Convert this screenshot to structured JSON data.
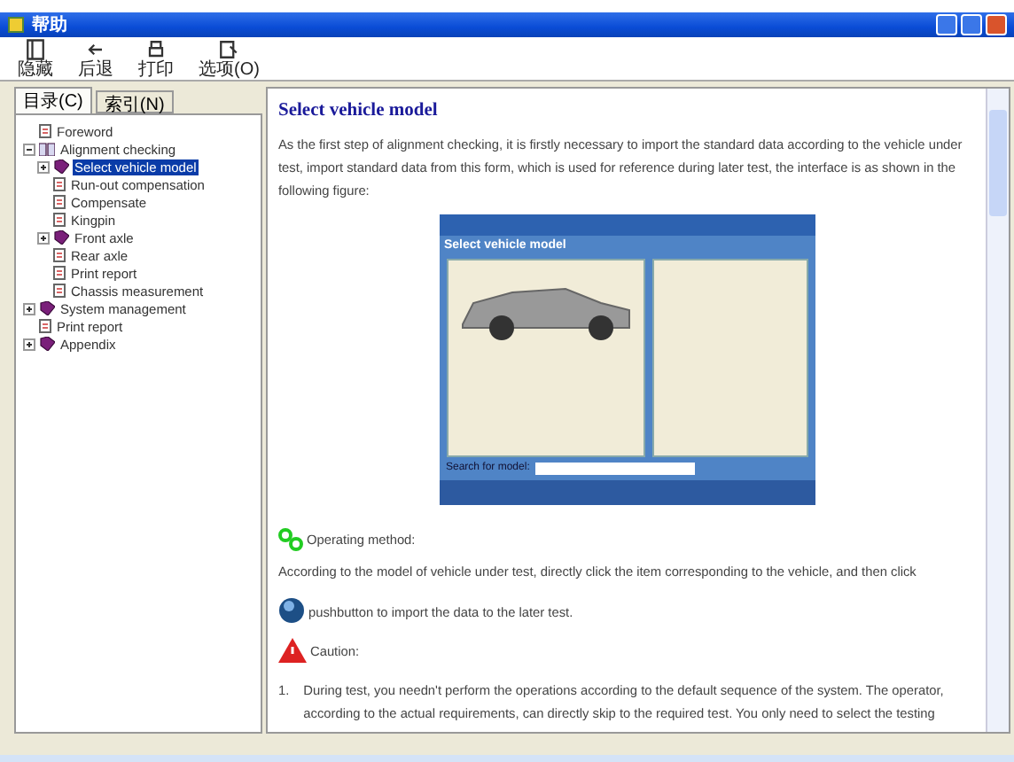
{
  "window": {
    "title": "帮助"
  },
  "toolbar": [
    {
      "label": "隐藏",
      "kind": "hide"
    },
    {
      "label": "后退",
      "kind": "back"
    },
    {
      "label": "打印",
      "kind": "print"
    },
    {
      "label": "选项(O)",
      "kind": "options"
    }
  ],
  "tabs": [
    {
      "label": "目录(C)",
      "selected": true
    },
    {
      "label": "索引(N)",
      "selected": false
    }
  ],
  "tree": [
    {
      "label": "Foreword",
      "kind": "page",
      "selected": false
    },
    {
      "label": "Alignment checking",
      "kind": "book",
      "expanded": true,
      "selected": false,
      "children": [
        {
          "label": "Select vehicle model",
          "kind": "book",
          "expanded": false,
          "selected": true
        },
        {
          "label": "Run-out compensation",
          "kind": "page",
          "selected": false
        },
        {
          "label": "Compensate",
          "kind": "page",
          "selected": false
        },
        {
          "label": "Kingpin",
          "kind": "page",
          "selected": false
        },
        {
          "label": "Front axle",
          "kind": "book",
          "expanded": false,
          "selected": false
        },
        {
          "label": "Rear axle",
          "kind": "page",
          "selected": false
        },
        {
          "label": "Print report",
          "kind": "page",
          "selected": false
        },
        {
          "label": "Chassis measurement",
          "kind": "page",
          "selected": false
        }
      ]
    },
    {
      "label": "System management",
      "kind": "book",
      "expanded": false,
      "selected": false
    },
    {
      "label": "Print report",
      "kind": "page",
      "selected": false
    },
    {
      "label": "Appendix",
      "kind": "book",
      "expanded": false,
      "selected": false
    }
  ],
  "content": {
    "heading": "Select vehicle model",
    "intro": "As the first step of alignment checking, it is firstly necessary to import the standard data according to the vehicle under test, import standard data from this form, which is used for reference during later test, the interface is as shown in the following figure:",
    "figure": {
      "title": "Select vehicle model",
      "search_label": "Search for model:"
    },
    "sections": [
      {
        "kind": "operating",
        "label": "Operating method:"
      },
      {
        "kind": "text",
        "text": "According to the model of vehicle under test, directly click the item corresponding to the vehicle, and then click"
      },
      {
        "kind": "button",
        "text": "pushbutton to import the data to the later test."
      },
      {
        "kind": "caution",
        "label": "Caution:"
      },
      {
        "kind": "numbered",
        "number": "1.",
        "text": "During test, you needn't perform the operations according to the default sequence of the system. The operator, according to the actual requirements, can directly skip to the required test. You only need to select the testing"
      }
    ]
  }
}
